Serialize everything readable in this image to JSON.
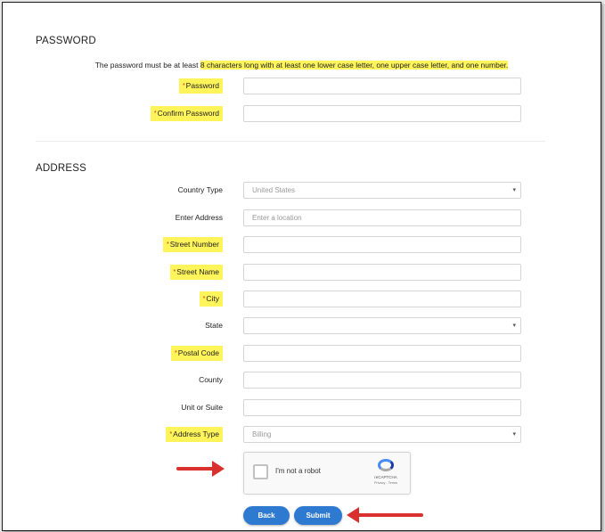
{
  "password_section": {
    "title": "PASSWORD",
    "rule_prefix": "The password must be at least ",
    "rule_highlight": "8 characters long with at least one lower case letter, one upper case letter, and one number.",
    "fields": {
      "password": {
        "label": "Password",
        "value": ""
      },
      "confirm_password": {
        "label": "Confirm Password",
        "value": ""
      }
    }
  },
  "address_section": {
    "title": "ADDRESS",
    "fields": {
      "country_type": {
        "label": "Country Type",
        "value": "United States"
      },
      "enter_address": {
        "label": "Enter Address",
        "placeholder": "Enter a location"
      },
      "street_number": {
        "label": "Street Number",
        "value": ""
      },
      "street_name": {
        "label": "Street Name",
        "value": ""
      },
      "city": {
        "label": "City",
        "value": ""
      },
      "state": {
        "label": "State",
        "value": ""
      },
      "postal_code": {
        "label": "Postal Code",
        "value": ""
      },
      "county": {
        "label": "County",
        "value": ""
      },
      "unit_or_suite": {
        "label": "Unit or Suite",
        "value": ""
      },
      "address_type": {
        "label": "Address Type",
        "value": "Billing"
      }
    }
  },
  "required_marker": "*",
  "dropdown_caret": "▾",
  "captcha": {
    "label": "I'm not a robot",
    "brand": "reCAPTCHA",
    "terms": "Privacy - Terms"
  },
  "buttons": {
    "back": "Back",
    "submit": "Submit"
  },
  "colors": {
    "highlight": "#fff55b",
    "button": "#2f7ad1",
    "arrow": "#d9312e",
    "required": "#dd2222"
  }
}
